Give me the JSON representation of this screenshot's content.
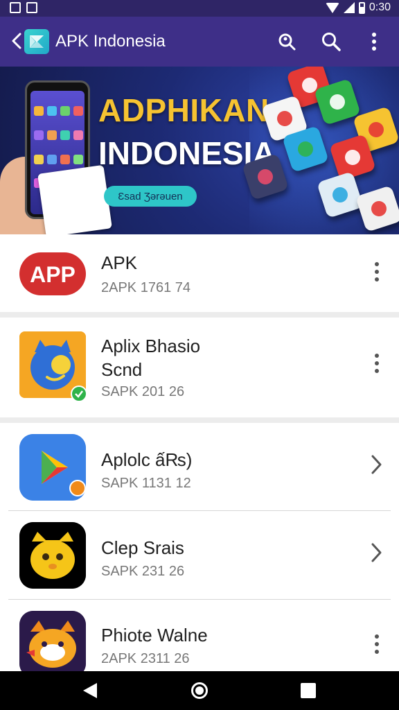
{
  "status_bar": {
    "time": "0:30"
  },
  "app_bar": {
    "title": "APK Indonesia"
  },
  "banner": {
    "title": "ADPHIKAN",
    "subtitle": "INDONESIA",
    "pill_text": "Ɛsad Ʒərəuen"
  },
  "apps": [
    {
      "name": "APK",
      "sub": "2APK 1761 74",
      "icon": "app-red-icon",
      "action": "more"
    },
    {
      "name": "Aplix Bhasio\nScnd",
      "sub": "SAPK 201 26",
      "icon": "blue-cat-icon",
      "action": "more"
    },
    {
      "name": "Aplolc ấ₨)",
      "sub": "SAPK 1131 12",
      "icon": "play-store-icon",
      "action": "chevron"
    },
    {
      "name": "Clep Srais",
      "sub": "SAPK 231 26",
      "icon": "yellow-cat-icon",
      "action": "chevron"
    },
    {
      "name": "Phiote Walne",
      "sub": "2APK 2311 26",
      "icon": "fox-mascot-icon",
      "action": "more"
    }
  ],
  "app_icon_label": "APP",
  "colors": {
    "app_bar": "#3e2f88",
    "status_bar": "#2f2566",
    "banner_title": "#f6c331",
    "banner_pill": "#2ec6c8"
  }
}
